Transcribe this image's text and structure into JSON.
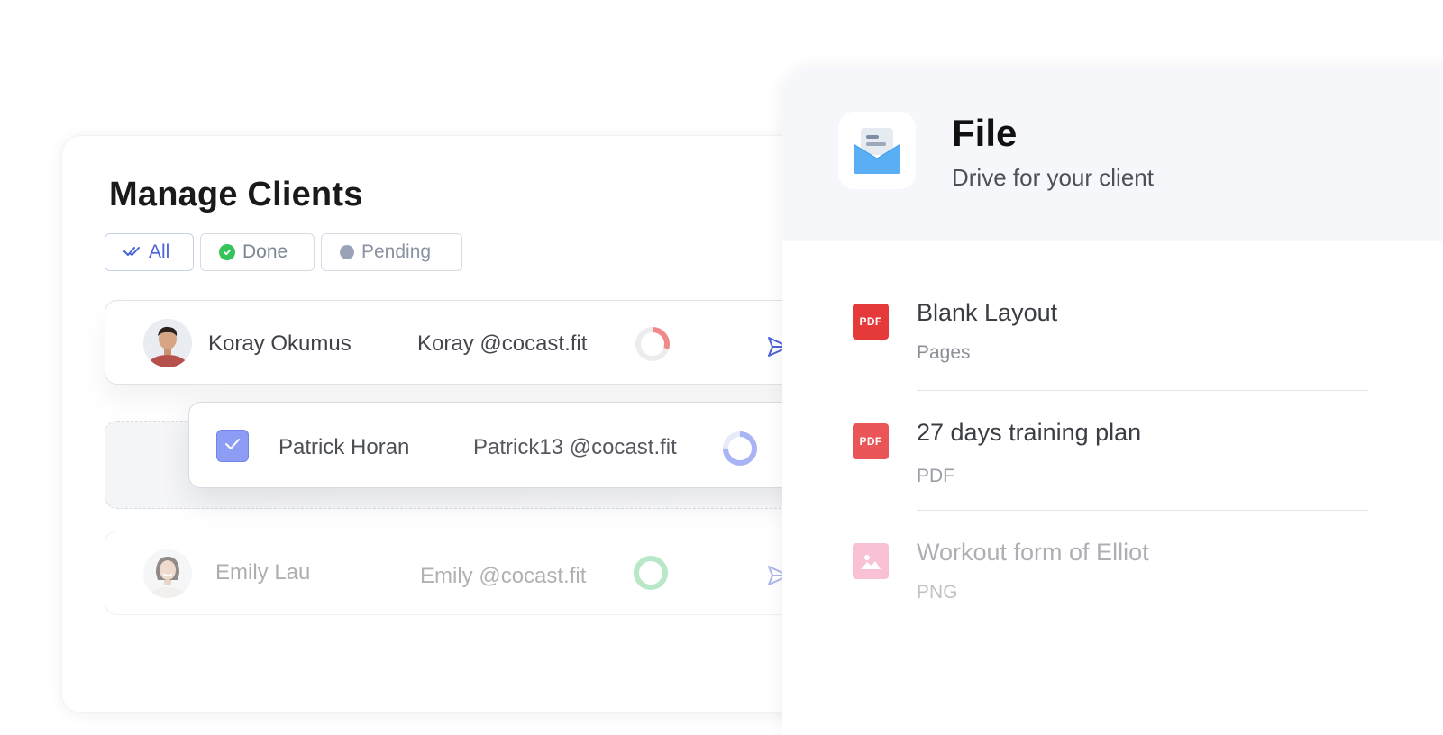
{
  "clients": {
    "title": "Manage Clients",
    "filters": [
      {
        "label": "All",
        "icon": "double-check-icon",
        "active": true
      },
      {
        "label": "Done",
        "icon": "check-circle-icon",
        "active": false
      },
      {
        "label": "Pending",
        "icon": "dot-icon",
        "active": false
      }
    ],
    "rows": [
      {
        "name": "Koray Okumus",
        "email": "Koray @cocast.fit",
        "progress": 0.3,
        "progress_color": "#f08a8a"
      },
      {
        "name": "Patrick Horan",
        "email": "Patrick13 @cocast.fit",
        "progress": 0.75,
        "progress_color": "#a9b4f4",
        "selected": true
      },
      {
        "name": "Emily Lau",
        "email": "Emily @cocast.fit",
        "progress": 1.0,
        "progress_color": "#7fd69a"
      }
    ]
  },
  "file_panel": {
    "title": "File",
    "subtitle": "Drive for your client",
    "icon": "mail-open-icon",
    "files": [
      {
        "name": "Blank Layout",
        "type": "Pages",
        "badge": "PDF",
        "badge_color": "#e5393a"
      },
      {
        "name": "27 days training plan",
        "type": "PDF",
        "badge": "PDF",
        "badge_color": "#ea5558"
      },
      {
        "name": "Workout form of Elliot",
        "type": "PNG",
        "badge_icon": "image-icon",
        "badge_color": "#f58fb5"
      }
    ]
  },
  "colors": {
    "accent": "#4a63d9",
    "done": "#36c45a",
    "pending": "#9aa3b5"
  }
}
